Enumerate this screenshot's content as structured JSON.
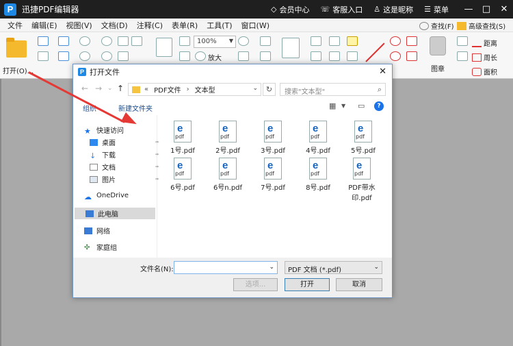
{
  "app": {
    "logo_letter": "P",
    "title": "迅捷PDF编辑器",
    "links": [
      {
        "icon": "diamond-icon",
        "label": "会员中心"
      },
      {
        "icon": "headset-icon",
        "label": "客服入口"
      },
      {
        "icon": "user-icon",
        "label": "这是昵称"
      },
      {
        "icon": "menu-icon",
        "label": "菜单"
      }
    ],
    "window": {
      "minimize": "—",
      "maximize": "□",
      "close": "✕"
    }
  },
  "menubar": [
    "文件",
    "编辑(E)",
    "视图(V)",
    "文档(D)",
    "注释(C)",
    "表单(R)",
    "工具(T)",
    "窗口(W)"
  ],
  "toolbar": {
    "open_label": "打开(O)...",
    "zoom_value": "100%",
    "zoom_in_label": "放大",
    "stamp_label": "图章",
    "find_label": "查找(F)",
    "advanced_find_label": "高级查找(S)",
    "distance_label": "距离",
    "perimeter_label": "周长",
    "area_label": "面积"
  },
  "dialog": {
    "title": "打开文件",
    "close": "✕",
    "path": [
      "PDF文件",
      "文本型"
    ],
    "path_prefix": "«",
    "search_placeholder": "搜索\"文本型\"",
    "organize": "组织",
    "new_folder": "新建文件夹",
    "help": "?",
    "nav": {
      "quick_access": "快速访问",
      "items": [
        "桌面",
        "下载",
        "文档",
        "图片"
      ],
      "onedrive": "OneDrive",
      "this_pc": "此电脑",
      "network": "网络",
      "homegroup": "家庭组"
    },
    "files": [
      "1号.pdf",
      "2号.pdf",
      "3号.pdf",
      "4号.pdf",
      "5号.pdf",
      "6号.pdf",
      "6号n.pdf",
      "7号.pdf",
      "8号.pdf",
      "PDF带水印.pdf"
    ],
    "file_icon_text": "pdf",
    "filename_label": "文件名(N):",
    "filename_value": "",
    "filetype": "PDF 文档 (*.pdf)",
    "options_btn": "选项...",
    "open_btn": "打开",
    "cancel_btn": "取消"
  },
  "colors": {
    "brand": "#1e88e5",
    "annotation_arrow": "#e53935"
  }
}
